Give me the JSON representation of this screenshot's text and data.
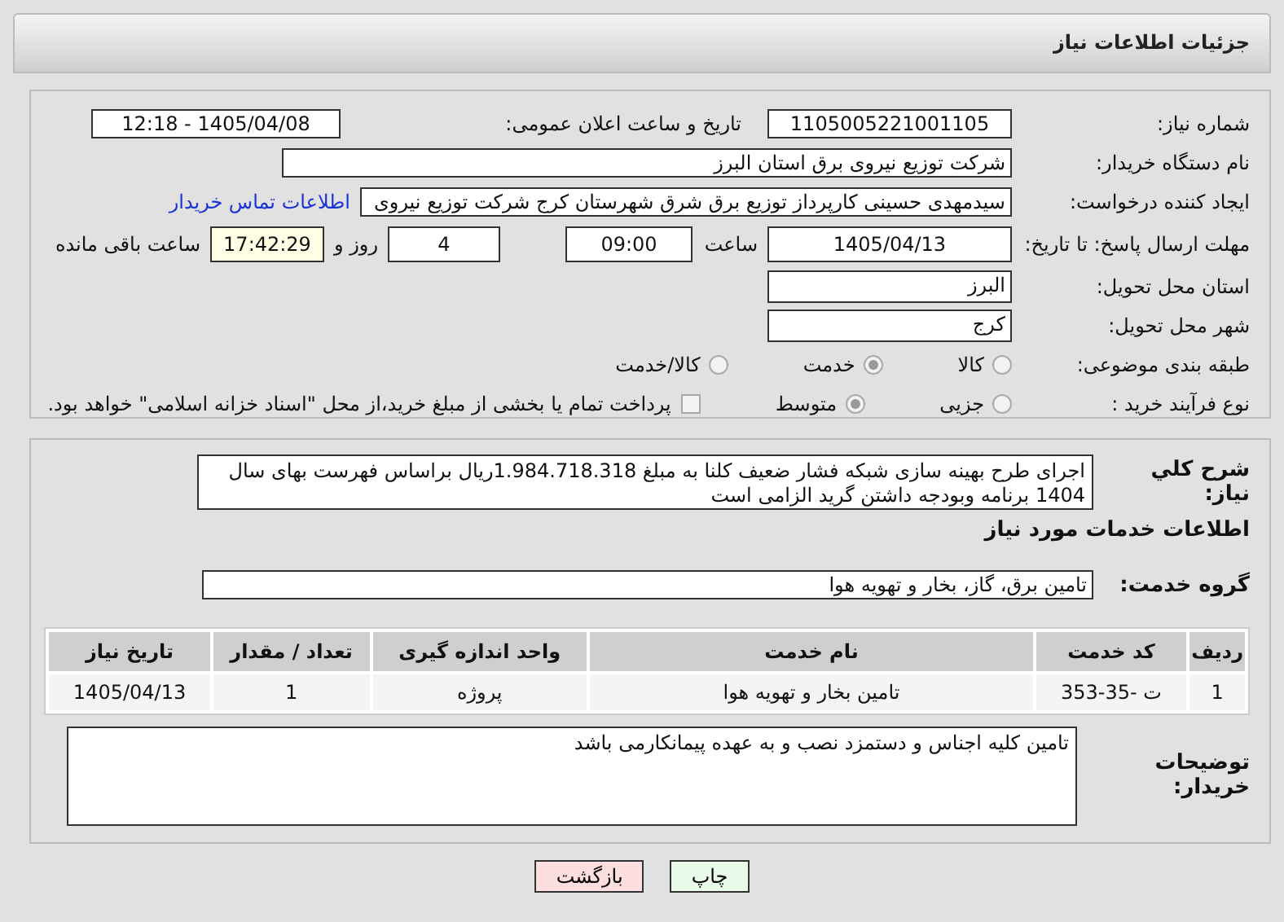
{
  "page_title": "جزئیات اطلاعات نیاز",
  "need_number": {
    "label": "شماره نیاز:",
    "value": "1105005221001105"
  },
  "announce_datetime": {
    "label": "تاریخ و ساعت اعلان عمومی:",
    "value": "1405/04/08 - 12:18"
  },
  "buyer_org": {
    "label": "نام دستگاه خریدار:",
    "value": "شرکت توزیع نیروی برق استان البرز"
  },
  "requester": {
    "label": "ایجاد کننده درخواست:",
    "value": "سیدمهدی حسینی کارپرداز توزیع برق شرق شهرستان کرج شرکت توزیع نیروی",
    "contact_link": "اطلاعات تماس خریدار"
  },
  "deadline": {
    "label": "مهلت ارسال پاسخ: تا تاریخ:",
    "date": "1405/04/13",
    "time_label": "ساعت",
    "time": "09:00",
    "days": "4",
    "days_label": "روز و",
    "remaining": "17:42:29",
    "remaining_label": "ساعت باقی مانده"
  },
  "province": {
    "label": "استان محل تحویل:",
    "value": "البرز"
  },
  "city": {
    "label": "شهر محل تحویل:",
    "value": "کرج"
  },
  "category": {
    "label": "طبقه بندی موضوعی:",
    "options": [
      {
        "label": "کالا",
        "selected": false
      },
      {
        "label": "خدمت",
        "selected": true
      },
      {
        "label": "کالا/خدمت",
        "selected": false
      }
    ]
  },
  "process_type": {
    "label": "نوع فرآیند خرید :",
    "options": [
      {
        "label": "جزیی",
        "selected": false
      },
      {
        "label": "متوسط",
        "selected": true
      }
    ],
    "treasury": {
      "checked": false,
      "text": "پرداخت تمام یا بخشی از مبلغ خرید،از محل \"اسناد خزانه اسلامی\" خواهد بود."
    }
  },
  "description": {
    "label": "شرح کلي نیاز:",
    "value": "اجرای طرح بهینه سازی شبکه فشار ضعیف کلنا به مبلغ 1.984.718.318ریال براساس فهرست بهای سال 1404 برنامه وبودجه داشتن گرید الزامی است"
  },
  "services_heading": "اطلاعات خدمات مورد نیاز",
  "service_group": {
    "label": "گروه خدمت:",
    "value": "تامین برق، گاز، بخار و تهویه هوا"
  },
  "table": {
    "columns": [
      "ردیف",
      "کد خدمت",
      "نام خدمت",
      "واحد اندازه گیری",
      "تعداد / مقدار",
      "تاریخ نیاز"
    ],
    "rows": [
      [
        "1",
        "ت -35-353",
        "تامین بخار و تهویه هوا",
        "پروژه",
        "1",
        "1405/04/13"
      ]
    ]
  },
  "buyer_notes": {
    "label": "توضیحات خریدار:",
    "value": "تامین کلیه اجناس و دستمزد نصب و به عهده پیمانکارمی باشد"
  },
  "buttons": [
    {
      "label": "چاپ",
      "kind": "print"
    },
    {
      "label": "بازگشت",
      "kind": "back"
    }
  ]
}
